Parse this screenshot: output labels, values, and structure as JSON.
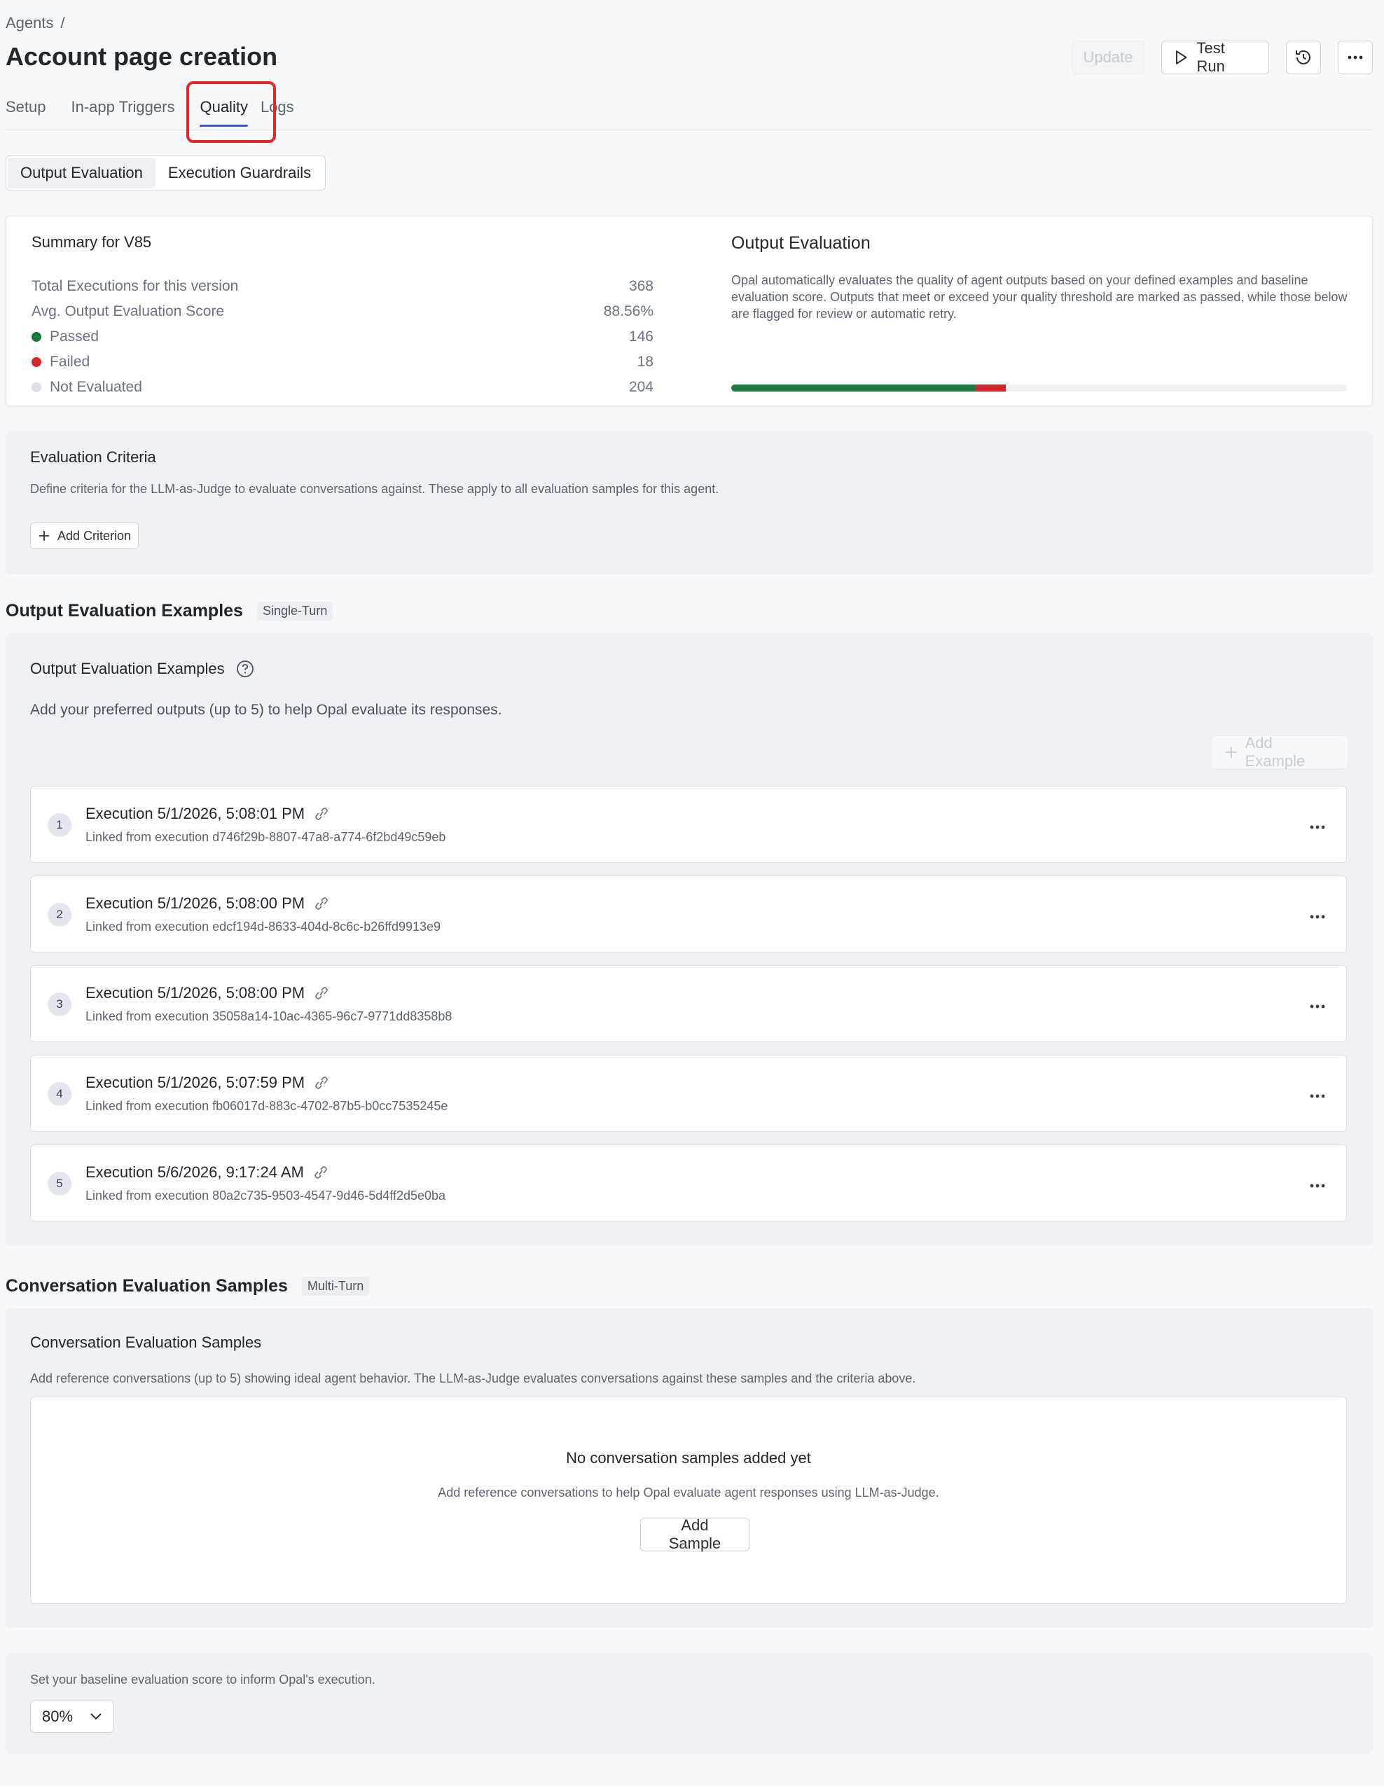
{
  "breadcrumb": {
    "parent": "Agents",
    "separator": "/"
  },
  "page": {
    "title": "Account page creation"
  },
  "header": {
    "update_label": "Update",
    "test_run_label": "Test Run"
  },
  "tabs": [
    {
      "label": "Setup"
    },
    {
      "label": "In-app Triggers"
    },
    {
      "label": "Quality",
      "active": true
    },
    {
      "label": "Logs"
    }
  ],
  "segments": [
    {
      "label": "Output Evaluation",
      "active": true
    },
    {
      "label": "Execution Guardrails"
    }
  ],
  "summary": {
    "title": "Summary for V85",
    "rows": [
      {
        "label": "Total Executions for this version",
        "value": "368"
      },
      {
        "label": "Avg. Output Evaluation Score",
        "value": "88.56%"
      },
      {
        "label": "Passed",
        "value": "146",
        "color": "#1b7a3e"
      },
      {
        "label": "Failed",
        "value": "18",
        "color": "#d4262b"
      },
      {
        "label": "Not Evaluated",
        "value": "204",
        "color": "#dde0e6"
      }
    ],
    "eval_title": "Output Evaluation",
    "eval_desc": "Opal automatically evaluates the quality of agent outputs based on your defined examples and baseline evaluation score. Outputs that meet or exceed your quality threshold are marked as passed, while those below are flagged for review or automatic retry.",
    "progress": {
      "passed": 146,
      "failed": 18,
      "total": 368
    }
  },
  "criteria": {
    "title": "Evaluation Criteria",
    "desc": "Define criteria for the LLM-as-Judge to evaluate conversations against. These apply to all evaluation samples for this agent.",
    "add_label": "Add Criterion"
  },
  "examples_section": {
    "heading": "Output Evaluation Examples",
    "tag": "Single-Turn",
    "title": "Output Evaluation Examples",
    "desc": "Add your preferred outputs (up to 5) to help Opal evaluate its responses.",
    "add_label": "Add Example",
    "items": [
      {
        "num": "1",
        "title": "Execution 5/1/2026, 5:08:01 PM",
        "sub": "Linked from execution d746f29b-8807-47a8-a774-6f2bd49c59eb"
      },
      {
        "num": "2",
        "title": "Execution 5/1/2026, 5:08:00 PM",
        "sub": "Linked from execution edcf194d-8633-404d-8c6c-b26ffd9913e9"
      },
      {
        "num": "3",
        "title": "Execution 5/1/2026, 5:08:00 PM",
        "sub": "Linked from execution 35058a14-10ac-4365-96c7-9771dd8358b8"
      },
      {
        "num": "4",
        "title": "Execution 5/1/2026, 5:07:59 PM",
        "sub": "Linked from execution fb06017d-883c-4702-87b5-b0cc7535245e"
      },
      {
        "num": "5",
        "title": "Execution 5/6/2026, 9:17:24 AM",
        "sub": "Linked from execution 80a2c735-9503-4547-9d46-5d4ff2d5e0ba"
      }
    ]
  },
  "conversation_section": {
    "heading": "Conversation Evaluation Samples",
    "tag": "Multi-Turn",
    "title": "Conversation Evaluation Samples",
    "desc": "Add reference conversations (up to 5) showing ideal agent behavior. The LLM-as-Judge evaluates conversations against these samples and the criteria above.",
    "empty_title": "No conversation samples added yet",
    "empty_desc": "Add reference conversations to help Opal evaluate agent responses using LLM-as-Judge.",
    "add_label": "Add Sample"
  },
  "baseline": {
    "desc": "Set your baseline evaluation score to inform Opal's execution.",
    "value": "80%"
  }
}
